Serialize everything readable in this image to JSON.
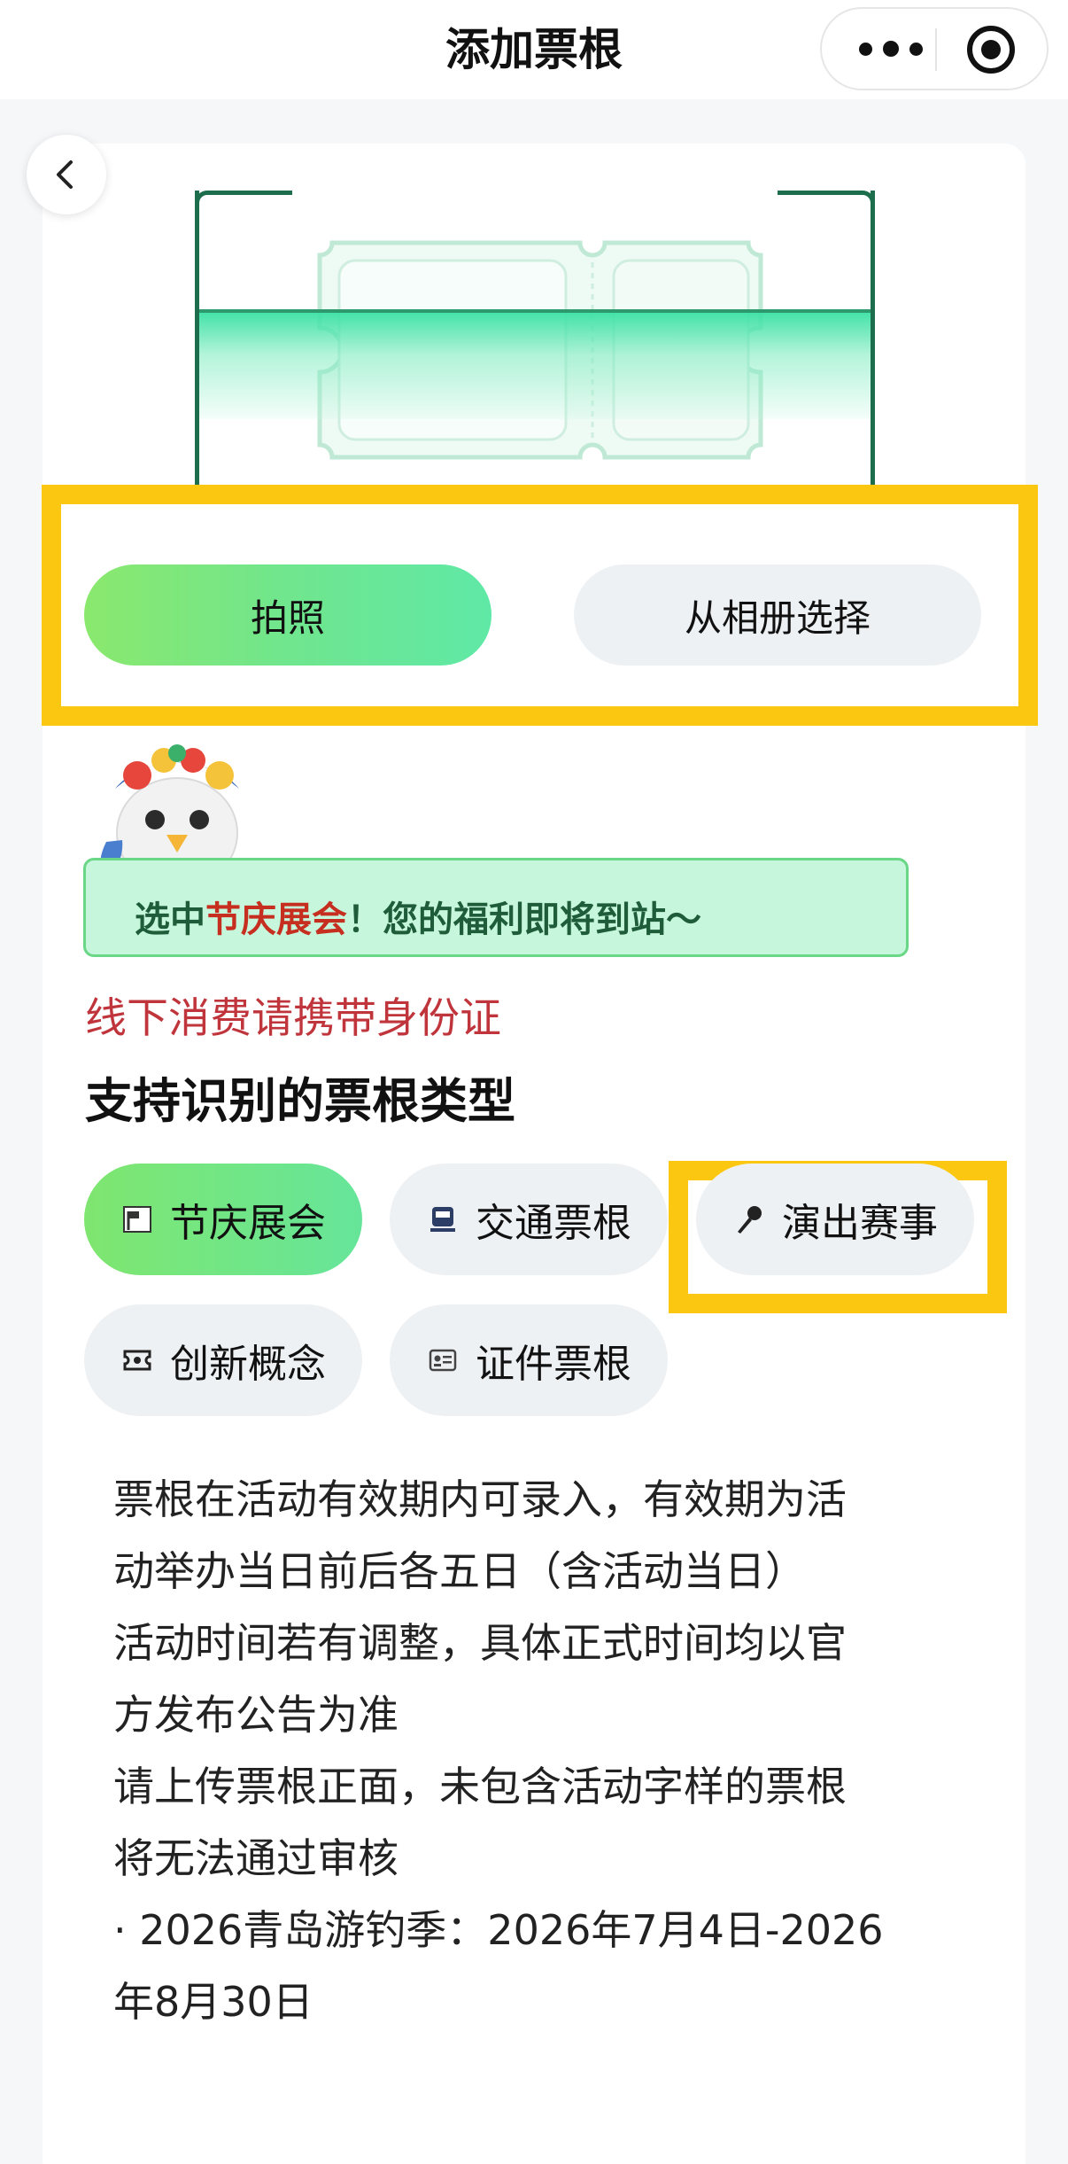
{
  "navbar": {
    "title": "添加票根",
    "icons": {
      "more": "more-dots-icon",
      "close": "target-close-icon",
      "back": "chevron-left-icon"
    }
  },
  "actions": {
    "photo_label": "拍照",
    "album_label": "从相册选择"
  },
  "banner": {
    "prefix": "选中",
    "highlight": "节庆展会",
    "suffix": "！您的福利即将到站～"
  },
  "notice": "线下消费请携带身份证",
  "section_title": "支持识别的票根类型",
  "categories": [
    {
      "label": "节庆展会",
      "icon": "festival-flag-icon",
      "selected": true
    },
    {
      "label": "交通票根",
      "icon": "train-icon",
      "selected": false
    },
    {
      "label": "演出赛事",
      "icon": "microphone-icon",
      "selected": false
    },
    {
      "label": "创新概念",
      "icon": "ticket-icon",
      "selected": false
    },
    {
      "label": "证件票根",
      "icon": "id-card-icon",
      "selected": false
    }
  ],
  "description": [
    "票根在活动有效期内可录入，有效期为活",
    "动举办当日前后各五日（含活动当日）",
    "活动时间若有调整，具体正式时间均以官",
    "方发布公告为准",
    "请上传票根正面，未包含活动字样的票根",
    "将无法通过审核",
    "· 2026青岛游钓季：2026年7月4日-2026",
    "年8月30日"
  ],
  "colors": {
    "highlight_box": "#fcc710",
    "accent_green": "#6ee694",
    "notice_red": "#c0353b",
    "banner_bg": "#c6f7dc"
  }
}
